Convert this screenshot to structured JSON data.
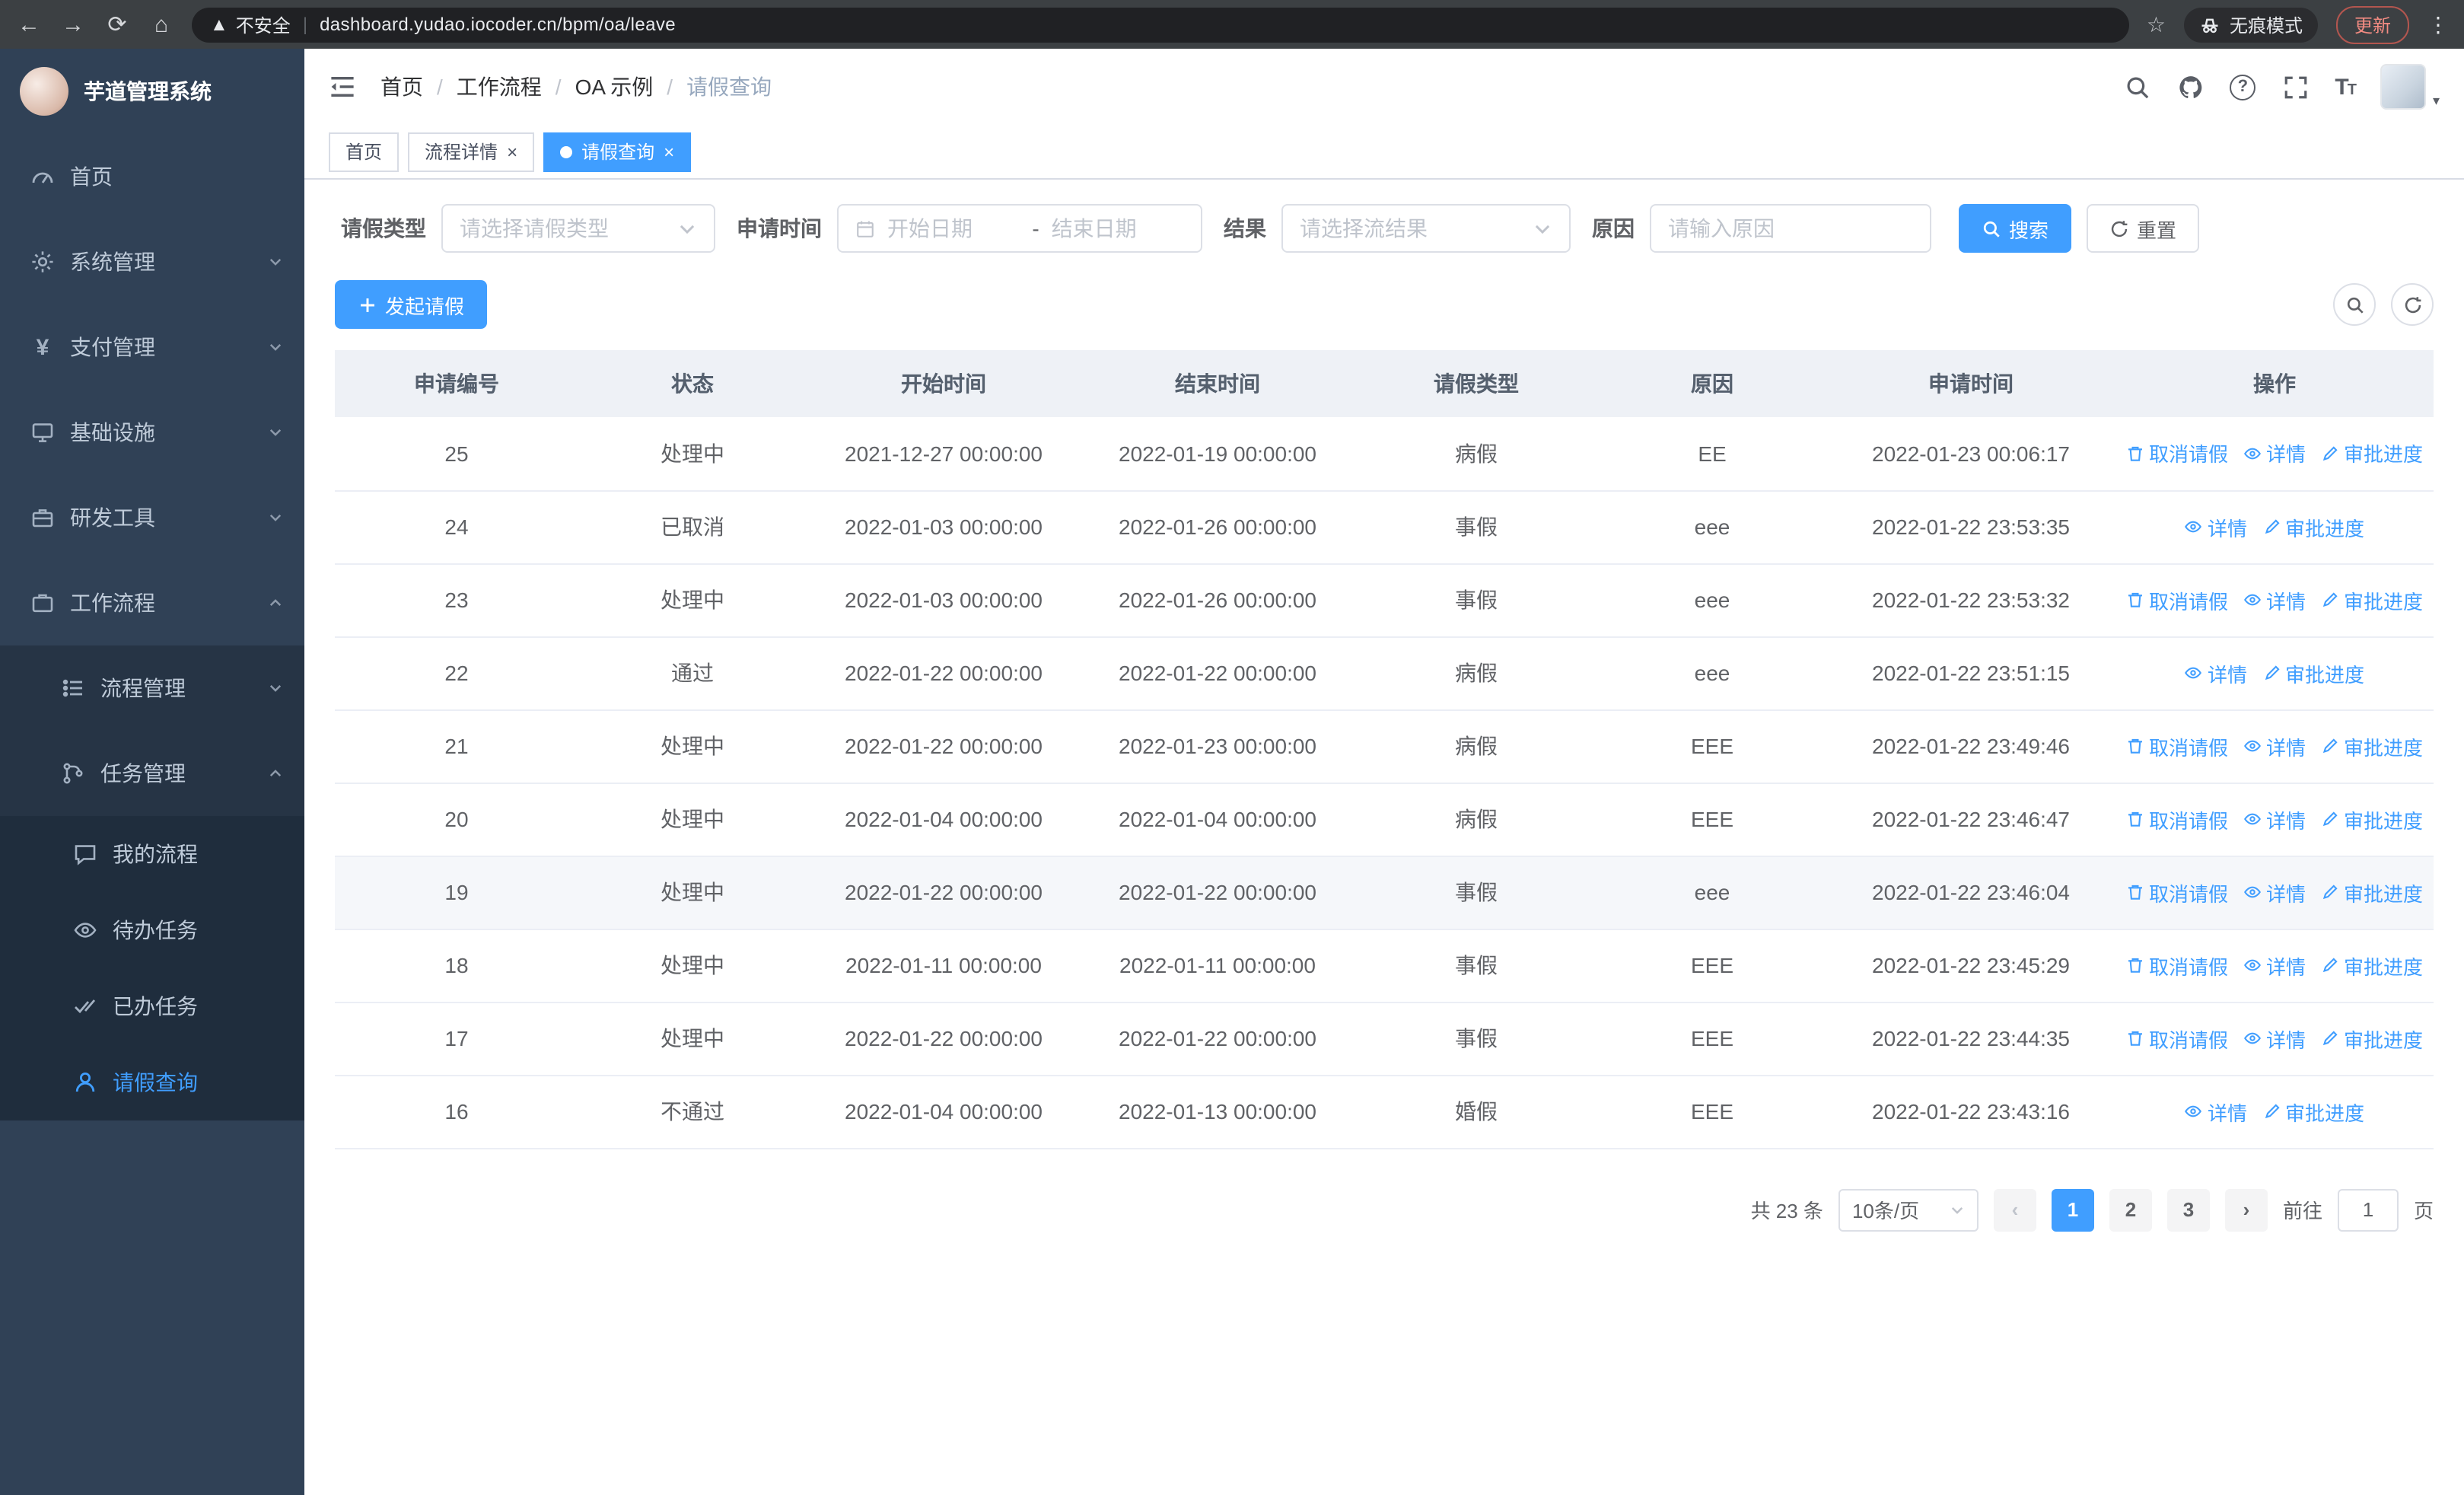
{
  "browser": {
    "security_warning": "不安全",
    "url": "dashboard.yudao.iocoder.cn/bpm/oa/leave",
    "incognito_label": "无痕模式",
    "update_label": "更新"
  },
  "sidebar": {
    "logo_title": "芋道管理系统",
    "home": "首页",
    "system": "系统管理",
    "payment": "支付管理",
    "infra": "基础设施",
    "devtools": "研发工具",
    "workflow": "工作流程",
    "process_mgmt": "流程管理",
    "task_mgmt": "任务管理",
    "my_process": "我的流程",
    "todo_tasks": "待办任务",
    "done_tasks": "已办任务",
    "leave_query": "请假查询"
  },
  "header": {
    "breadcrumb": [
      "首页",
      "工作流程",
      "OA 示例",
      "请假查询"
    ]
  },
  "tabs": {
    "home": "首页",
    "process_detail": "流程详情",
    "leave_query": "请假查询"
  },
  "filters": {
    "leave_type_label": "请假类型",
    "leave_type_placeholder": "请选择请假类型",
    "apply_time_label": "申请时间",
    "start_date_placeholder": "开始日期",
    "range_separator": "-",
    "end_date_placeholder": "结束日期",
    "result_label": "结果",
    "result_placeholder": "请选择流结果",
    "reason_label": "原因",
    "reason_placeholder": "请输入原因",
    "search_button": "搜索",
    "reset_button": "重置"
  },
  "toolbar": {
    "create_button": "发起请假"
  },
  "table": {
    "columns": [
      "申请编号",
      "状态",
      "开始时间",
      "结束时间",
      "请假类型",
      "原因",
      "申请时间",
      "操作"
    ],
    "action_labels": {
      "cancel": "取消请假",
      "detail": "详情",
      "progress": "审批进度"
    },
    "rows": [
      {
        "id": "25",
        "status": "处理中",
        "start": "2021-12-27 00:00:00",
        "end": "2022-01-19 00:00:00",
        "type": "病假",
        "reason": "EE",
        "applied": "2022-01-23 00:06:17",
        "actions": [
          "cancel",
          "detail",
          "progress"
        ],
        "highlighted": false
      },
      {
        "id": "24",
        "status": "已取消",
        "start": "2022-01-03 00:00:00",
        "end": "2022-01-26 00:00:00",
        "type": "事假",
        "reason": "eee",
        "applied": "2022-01-22 23:53:35",
        "actions": [
          "detail",
          "progress"
        ],
        "highlighted": false
      },
      {
        "id": "23",
        "status": "处理中",
        "start": "2022-01-03 00:00:00",
        "end": "2022-01-26 00:00:00",
        "type": "事假",
        "reason": "eee",
        "applied": "2022-01-22 23:53:32",
        "actions": [
          "cancel",
          "detail",
          "progress"
        ],
        "highlighted": false
      },
      {
        "id": "22",
        "status": "通过",
        "start": "2022-01-22 00:00:00",
        "end": "2022-01-22 00:00:00",
        "type": "病假",
        "reason": "eee",
        "applied": "2022-01-22 23:51:15",
        "actions": [
          "detail",
          "progress"
        ],
        "highlighted": false
      },
      {
        "id": "21",
        "status": "处理中",
        "start": "2022-01-22 00:00:00",
        "end": "2022-01-23 00:00:00",
        "type": "病假",
        "reason": "EEE",
        "applied": "2022-01-22 23:49:46",
        "actions": [
          "cancel",
          "detail",
          "progress"
        ],
        "highlighted": false
      },
      {
        "id": "20",
        "status": "处理中",
        "start": "2022-01-04 00:00:00",
        "end": "2022-01-04 00:00:00",
        "type": "病假",
        "reason": "EEE",
        "applied": "2022-01-22 23:46:47",
        "actions": [
          "cancel",
          "detail",
          "progress"
        ],
        "highlighted": false
      },
      {
        "id": "19",
        "status": "处理中",
        "start": "2022-01-22 00:00:00",
        "end": "2022-01-22 00:00:00",
        "type": "事假",
        "reason": "eee",
        "applied": "2022-01-22 23:46:04",
        "actions": [
          "cancel",
          "detail",
          "progress"
        ],
        "highlighted": true
      },
      {
        "id": "18",
        "status": "处理中",
        "start": "2022-01-11 00:00:00",
        "end": "2022-01-11 00:00:00",
        "type": "事假",
        "reason": "EEE",
        "applied": "2022-01-22 23:45:29",
        "actions": [
          "cancel",
          "detail",
          "progress"
        ],
        "highlighted": false
      },
      {
        "id": "17",
        "status": "处理中",
        "start": "2022-01-22 00:00:00",
        "end": "2022-01-22 00:00:00",
        "type": "事假",
        "reason": "EEE",
        "applied": "2022-01-22 23:44:35",
        "actions": [
          "cancel",
          "detail",
          "progress"
        ],
        "highlighted": false
      },
      {
        "id": "16",
        "status": "不通过",
        "start": "2022-01-04 00:00:00",
        "end": "2022-01-13 00:00:00",
        "type": "婚假",
        "reason": "EEE",
        "applied": "2022-01-22 23:43:16",
        "actions": [
          "detail",
          "progress"
        ],
        "highlighted": false
      }
    ]
  },
  "pagination": {
    "total_text": "共 23 条",
    "page_size": "10条/页",
    "pages": [
      "1",
      "2",
      "3"
    ],
    "active_page": "1",
    "goto_prefix": "前往",
    "goto_value": "1",
    "goto_suffix": "页"
  },
  "colors": {
    "accent": "#409eff",
    "sidebar_bg": "#304156",
    "sidebar_sub_bg": "#263445",
    "sidebar_leaf_bg": "#1f2d3d",
    "chrome_bg": "#3c4043",
    "update_red": "#f28b82"
  }
}
